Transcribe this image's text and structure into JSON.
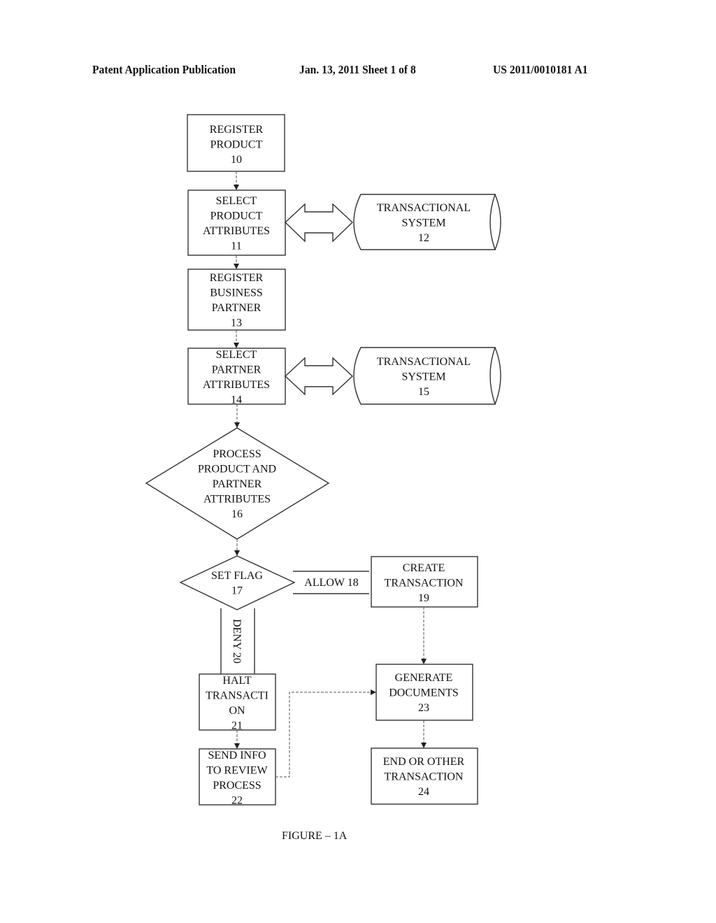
{
  "header": {
    "left": "Patent Application Publication",
    "middle": "Jan. 13, 2011  Sheet 1 of 8",
    "right": "US 2011/0010181 A1"
  },
  "nodes": {
    "n10": {
      "lines": [
        "REGISTER",
        "PRODUCT",
        "10"
      ],
      "shape": "rect"
    },
    "n11": {
      "lines": [
        "SELECT",
        "PRODUCT",
        "ATTRIBUTES",
        "11"
      ],
      "shape": "rect"
    },
    "n12": {
      "lines": [
        "TRANSACTIONAL",
        "SYSTEM",
        "12"
      ],
      "shape": "stored-data"
    },
    "n13": {
      "lines": [
        "REGISTER",
        "BUSINESS",
        "PARTNER",
        "13"
      ],
      "shape": "rect"
    },
    "n14": {
      "lines": [
        "SELECT",
        "PARTNER",
        "ATTRIBUTES",
        "14"
      ],
      "shape": "rect"
    },
    "n15": {
      "lines": [
        "TRANSACTIONAL",
        "SYSTEM",
        "15"
      ],
      "shape": "stored-data"
    },
    "n16": {
      "lines": [
        "PROCESS",
        "PRODUCT AND",
        "PARTNER",
        "ATTRIBUTES",
        "16"
      ],
      "shape": "diamond"
    },
    "n17": {
      "lines": [
        "SET FLAG",
        "17"
      ],
      "shape": "diamond"
    },
    "n19": {
      "lines": [
        "CREATE",
        "TRANSACTION",
        "19"
      ],
      "shape": "rect"
    },
    "n21": {
      "lines": [
        "HALT",
        "TRANSACTI",
        "ON",
        "21"
      ],
      "shape": "rect"
    },
    "n22": {
      "lines": [
        "SEND INFO",
        "TO REVIEW",
        "PROCESS",
        "22"
      ],
      "shape": "rect"
    },
    "n23": {
      "lines": [
        "GENERATE",
        "DOCUMENTS",
        "23"
      ],
      "shape": "rect"
    },
    "n24": {
      "lines": [
        "END OR OTHER",
        "TRANSACTION",
        "24"
      ],
      "shape": "rect"
    }
  },
  "edges": {
    "allow": "ALLOW 18",
    "deny": "DENY 20"
  },
  "caption": "FIGURE – 1A"
}
